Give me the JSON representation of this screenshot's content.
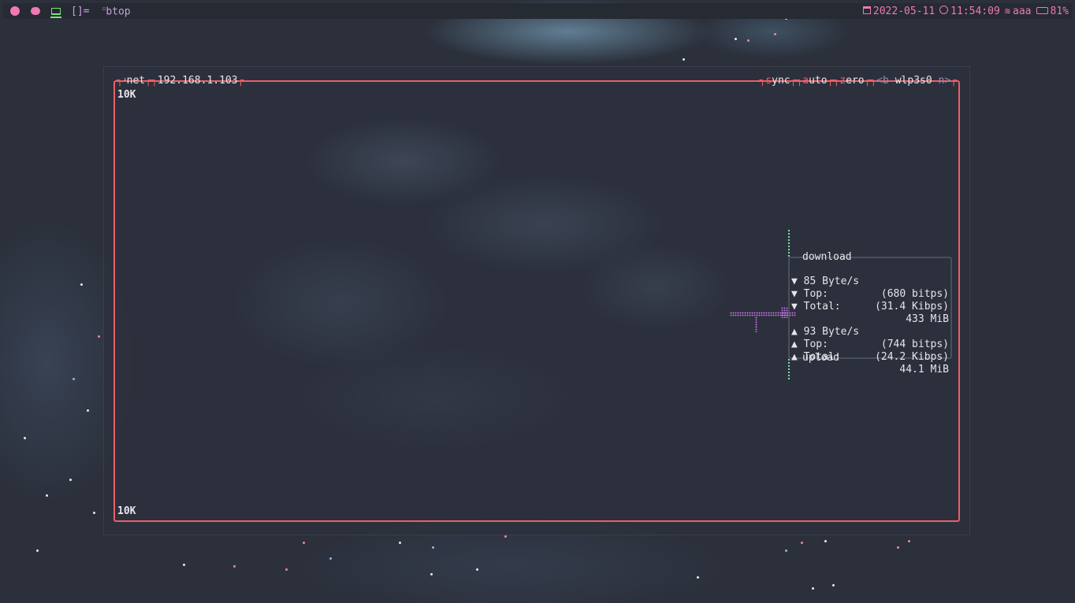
{
  "topbar": {
    "workspaces": [
      {
        "icon": "firefox-icon",
        "active": false
      },
      {
        "icon": "messenger-icon",
        "active": false
      },
      {
        "icon": "laptop-icon",
        "active": true
      }
    ],
    "layout_symbol": "[]=",
    "window_title": "btop",
    "date": "2022-05-11",
    "time": "11:54:09",
    "wifi_name": "aaa",
    "battery": "81%",
    "accent_color": "#f078b4",
    "active_color": "#7ee37e"
  },
  "net": {
    "title_sup": "³",
    "title": "net",
    "ip": "192.168.1.103",
    "buttons": {
      "sync_hl": "s",
      "sync_rest": "ync",
      "auto_hl": "a",
      "auto_rest": "uto",
      "zero_hl": "z",
      "zero_rest": "ero",
      "prev": "<b",
      "interface": "wlp3s0",
      "next": "n>"
    },
    "scale_top": "10K",
    "scale_bottom": "10K",
    "border_color": "#ea5f67",
    "download": {
      "label": "download",
      "rate_label": "85 Byte/s",
      "rate_bits": "(680 bitps)",
      "top_label": "Top:",
      "top_value": "(31.4 Kibps)",
      "total_label": "Total:",
      "total_value": "433 MiB",
      "arrow": "▼"
    },
    "upload": {
      "label": "upload",
      "rate_label": "93 Byte/s",
      "rate_bits": "(744 bitps)",
      "top_label": "Top:",
      "top_value": "(24.2 Kibps)",
      "total_label": "Total:",
      "total_value": "44.1 MiB",
      "arrow": "▲"
    }
  }
}
